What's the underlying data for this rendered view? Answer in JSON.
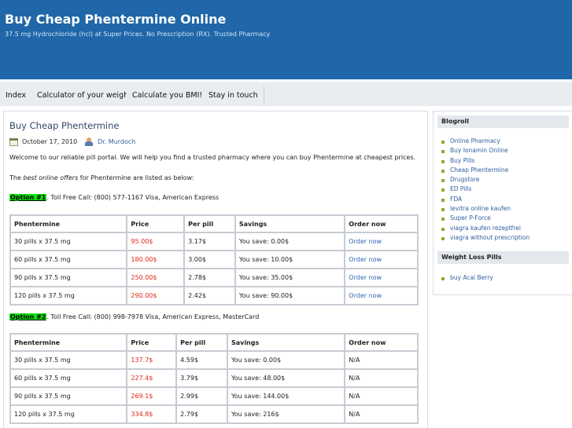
{
  "header": {
    "title": "Buy Cheap Phentermine Online",
    "description": "37.5 mg Hydrochloride (hcl) at Super Prices. No Prescription (RX). Trusted Pharmacy"
  },
  "nav": {
    "items": [
      "Index",
      "Calculator of your weight",
      "Calculate you BMI!",
      "Stay in touch"
    ]
  },
  "post": {
    "title": "Buy Cheap Phentermine",
    "date": "October 17, 2010",
    "author": "Dr. Murdoch",
    "intro": "Welcome to our reliable pill portal. We will help you find a trusted pharmacy where you can buy Phentermine at cheapest prices.",
    "offers_prefix": "The ",
    "offers_em": "best online offers",
    "offers_suffix": " for Phentermine are listed as below:"
  },
  "options": [
    {
      "badge": "Option #1",
      "text": ". Toll Free Call: (800) 577-1167 Visa, American Express",
      "headers": [
        "Phentermine",
        "Price",
        "Per pill",
        "Savings",
        "Order now"
      ],
      "rows": [
        [
          "30 pills x 37.5 mg",
          "95.00$",
          "3.17$",
          "You save: 0.00$",
          "Order now"
        ],
        [
          "60 pills x 37.5 mg",
          "180.00$",
          "3.00$",
          "You save: 10.00$",
          "Order now"
        ],
        [
          "90 pills x 37.5 mg",
          "250.00$",
          "2.78$",
          "You save: 35.00$",
          "Order now"
        ],
        [
          "120 pills x 37.5 mg",
          "290.00$",
          "2.42$",
          "You save: 90.00$",
          "Order now"
        ]
      ]
    },
    {
      "badge": "Option #2",
      "text": ". Toll Free Call: (800) 998-7978 Visa, American Express, MasterCard",
      "headers": [
        "Phentermine",
        "Price",
        "Per pill",
        "Savings",
        "Order now"
      ],
      "rows": [
        [
          "30 pills x 37.5 mg",
          "137.7$",
          "4.59$",
          "You save: 0.00$",
          "N/A"
        ],
        [
          "60 pills x 37.5 mg",
          "227.4$",
          "3.79$",
          "You save: 48.00$",
          "N/A"
        ],
        [
          "90 pills x 37.5 mg",
          "269.1$",
          "2.99$",
          "You save: 144.00$",
          "N/A"
        ],
        [
          "120 pills x 37.5 mg",
          "334.8$",
          "2.79$",
          "You save: 216$",
          "N/A"
        ]
      ]
    }
  ],
  "sidebar": {
    "blogroll_title": "Blogroll",
    "blogroll": [
      "Online Pharmacy",
      "Buy Ionamin Online",
      "Buy Pills",
      "Cheap Phentermine",
      "Drugstore",
      "ED Pills",
      "FDA",
      "levitra online kaufen",
      "Super P-Force",
      "viagra kaufen rezeptfrei",
      "viagra without prescription"
    ],
    "weightloss_title": "Weight Loss Pills",
    "weightloss": [
      "buy Acai Berry"
    ]
  },
  "colors": {
    "header_bg": "#1f67a9",
    "badge_bg": "#11e011",
    "price_red": "#e0261b",
    "link_blue": "#2e67b2"
  }
}
